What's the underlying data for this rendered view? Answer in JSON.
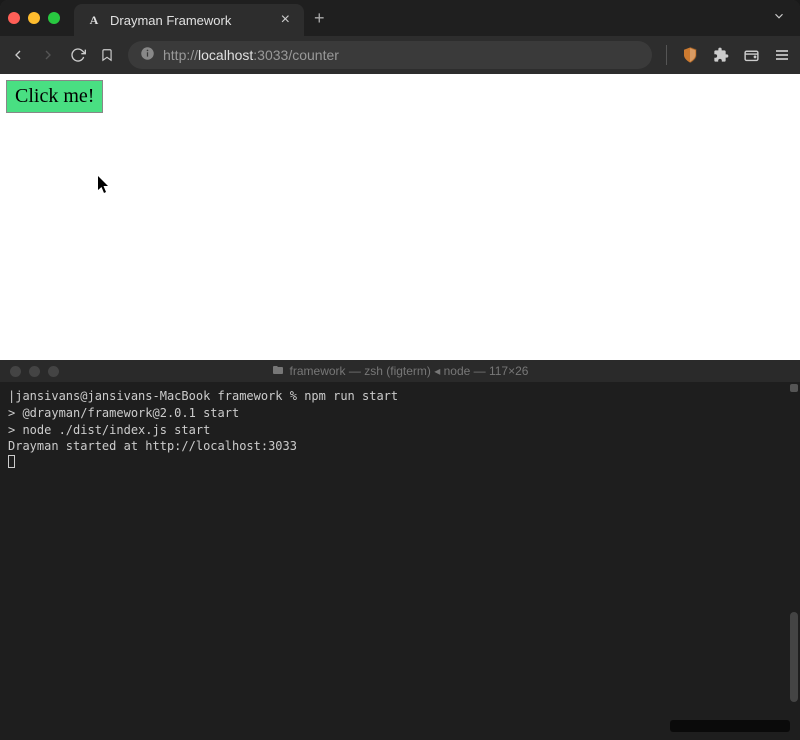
{
  "browser": {
    "tab": {
      "favicon_letter": "A",
      "title": "Drayman Framework"
    },
    "address": {
      "protocol": "http://",
      "host": "localhost",
      "port": ":3033",
      "path": "/counter"
    }
  },
  "page": {
    "button_label": "Click me!"
  },
  "terminal": {
    "title": "framework — zsh (figterm) ◂ node — 117×26",
    "lines": [
      "|jansivans@jansivans-MacBook framework % npm run start",
      "",
      "> @drayman/framework@2.0.1 start",
      "> node ./dist/index.js start",
      "",
      "Drayman started at http://localhost:3033"
    ]
  }
}
